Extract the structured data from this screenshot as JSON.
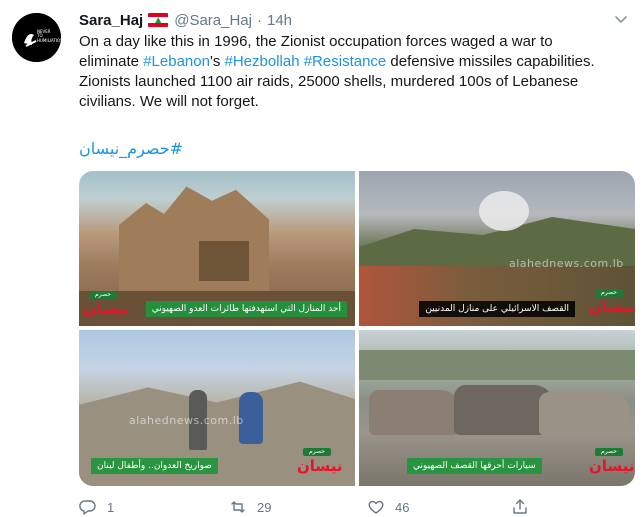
{
  "author": {
    "name": "Sara_Haj",
    "handle": "@Sara_Haj",
    "separator": "·",
    "time": "14h",
    "avatar_text": "NEVER TO HUMILIATION"
  },
  "tweet": {
    "line1": "On a day like this in 1996, the Zionist occupation forces waged a war to",
    "line2_prefix": "eliminate ",
    "tag_lebanon": "#Lebanon",
    "line2_mid": "'s ",
    "tag_hezbollah": "#Hezbollah",
    "space": " ",
    "tag_resistance": "#Resistance",
    "line2_suffix": " defensive missiles capabilities.",
    "line3": "Zionists launched 1100 air raids, 25000 shells, murdered 100s of Lebanese",
    "line4": "civilians. We will not forget.",
    "arabic_hashtag": "#حصرم_نيسان"
  },
  "media": {
    "images": [
      {
        "caption": "أحد المنازل التي استهدفتها طائرات العدو الصهيوني",
        "badge_small": "حصرم",
        "badge_big": "نيسان"
      },
      {
        "caption": "القصف الاسرائيلي على منازل المدنيين",
        "badge_small": "حصرم",
        "badge_big": "نيسان",
        "watermark": "alahednews.com.lb"
      },
      {
        "caption": "صواريخ العدوان.. وأطفال لبنان",
        "badge_small": "حصرم",
        "badge_big": "نيسان",
        "watermark": "alahednews.com.lb"
      },
      {
        "caption": "سيارات أحرقها القصف الصهيوني",
        "badge_small": "حصرم",
        "badge_big": "نيسان"
      }
    ]
  },
  "actions": {
    "reply_count": "1",
    "retweet_count": "29",
    "like_count": "46"
  },
  "colors": {
    "link": "#1b95e0",
    "muted": "#657786",
    "caption_bg": "#20963c",
    "badge_red": "#e8132b"
  }
}
